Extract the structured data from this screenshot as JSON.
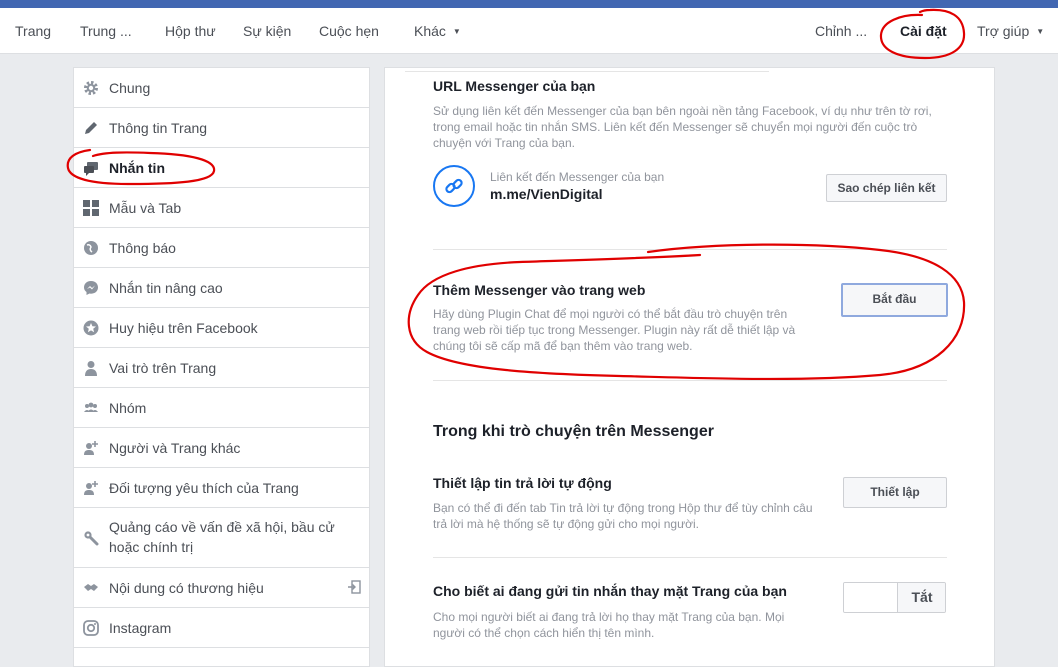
{
  "nav": {
    "left_items": [
      "Trang",
      "Trung ...",
      "Hộp thư",
      "Sự kiện",
      "Cuộc hẹn",
      "Khác"
    ],
    "right_items": [
      "Chỉnh ...",
      "Cài đặt",
      "Trợ giúp"
    ]
  },
  "sidebar": {
    "items": [
      {
        "label": "Chung",
        "icon": "gear-icon"
      },
      {
        "label": "Thông tin Trang",
        "icon": "pencil-icon"
      },
      {
        "label": "Nhắn tin",
        "icon": "chat-bubbles-icon"
      },
      {
        "label": "Mẫu và Tab",
        "icon": "grid-icon"
      },
      {
        "label": "Thông báo",
        "icon": "globe-icon"
      },
      {
        "label": "Nhắn tin nâng cao",
        "icon": "messenger-icon"
      },
      {
        "label": "Huy hiệu trên Facebook",
        "icon": "star-badge-icon"
      },
      {
        "label": "Vai trò trên Trang",
        "icon": "person-icon"
      },
      {
        "label": "Nhóm",
        "icon": "group-icon"
      },
      {
        "label": "Người và Trang khác",
        "icon": "person-add-icon"
      },
      {
        "label": "Đối tượng yêu thích của Trang",
        "icon": "person-add-icon"
      },
      {
        "label": "Quảng cáo về vấn đề xã hội, bầu cử hoặc chính trị",
        "icon": "wrench-icon"
      },
      {
        "label": "Nội dung có thương hiệu",
        "icon": "handshake-icon"
      },
      {
        "label": "Instagram",
        "icon": "instagram-icon"
      }
    ]
  },
  "main": {
    "url_section": {
      "title": "URL Messenger của bạn",
      "desc": "Sử dụng liên kết đến Messenger của bạn bên ngoài nền tảng Facebook, ví dụ như trên tờ rơi, trong email hoặc tin nhắn SMS. Liên kết đến Messenger sẽ chuyển mọi người đến cuộc trò chuyện với Trang của bạn.",
      "link_caption": "Liên kết đến Messenger của bạn",
      "link_value": "m.me/VienDigital",
      "copy_button": "Sao chép liên kết"
    },
    "plugin_section": {
      "title": "Thêm Messenger vào trang web",
      "desc": "Hãy dùng Plugin Chat để mọi người có thể bắt đầu trò chuyện trên trang web rồi tiếp tục trong Messenger. Plugin này rất dễ thiết lập và chúng tôi sẽ cấp mã để bạn thêm vào trang web.",
      "button": "Bắt đầu"
    },
    "while_chatting": {
      "title": "Trong khi trò chuyện trên Messenger"
    },
    "auto_reply": {
      "title": "Thiết lập tin trả lời tự động",
      "desc": "Bạn có thể đi đến tab Tin trả lời tự động trong Hộp thư để tùy chỉnh câu trả lời mà hệ thống sẽ tự động gửi cho mọi người.",
      "button": "Thiết lập"
    },
    "show_sender": {
      "title": "Cho biết ai đang gửi tin nhắn thay mặt Trang của bạn",
      "desc": "Cho mọi người biết ai đang trả lời họ thay mặt Trang của bạn. Mọi người có thể chọn cách hiển thị tên mình.",
      "toggle_label": "Tắt"
    }
  },
  "colors": {
    "brand_blue": "#4267b2",
    "messenger_blue": "#1877f2",
    "annotation_red": "#e00000"
  }
}
